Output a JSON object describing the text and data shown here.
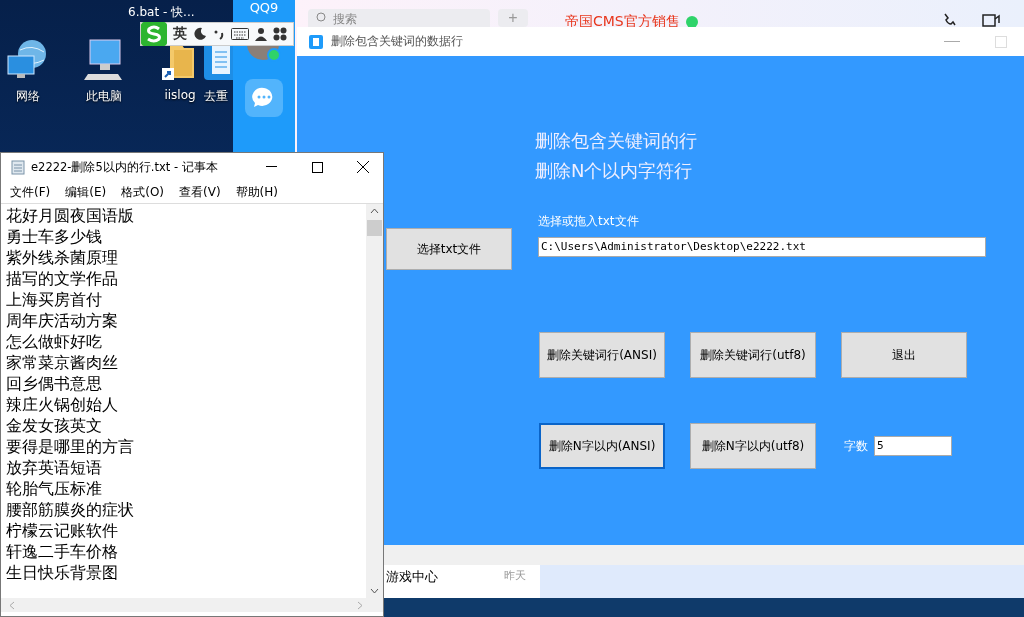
{
  "desktop": {
    "top_label": "6.bat - 快...",
    "icons": [
      {
        "label": "网络",
        "kind": "network"
      },
      {
        "label": "此电脑",
        "kind": "computer"
      },
      {
        "label": "iislog",
        "kind": "folder"
      },
      {
        "label": "去重",
        "kind": "app"
      }
    ]
  },
  "ime_bar": {
    "mode": "英"
  },
  "qq": {
    "logo": "QQ9",
    "search": {
      "placeholder": "搜索"
    },
    "add": "+",
    "chat_title": "帝国CMS官方销售",
    "online": true,
    "list": [
      {
        "name": "游戏中心",
        "time": "昨天"
      }
    ]
  },
  "app_window": {
    "title": "删除包含关键词的数据行",
    "headings": [
      "删除包含关键词的行",
      "删除N个以内字符行"
    ],
    "choose_button": "选择txt文件",
    "file_label": "选择或拖入txt文件",
    "file_path": "C:\\Users\\Administrator\\Desktop\\e2222.txt",
    "buttons": [
      {
        "label": "删除关键词行(ANSI)",
        "focused": false
      },
      {
        "label": "删除关键词行(utf8)",
        "focused": false
      },
      {
        "label": "退出",
        "focused": false
      },
      {
        "label": "删除N字以内(ANSI)",
        "focused": true
      },
      {
        "label": "删除N字以内(utf8)",
        "focused": false
      }
    ],
    "count_label": "字数",
    "count_value": "5"
  },
  "notepad": {
    "title": "e2222-删除5以内的行.txt - 记事本",
    "menu": [
      "文件(F)",
      "编辑(E)",
      "格式(O)",
      "查看(V)",
      "帮助(H)"
    ],
    "lines": [
      "花好月圆夜国语版",
      "勇士车多少钱",
      "紫外线杀菌原理",
      "描写的文学作品",
      "上海买房首付",
      "周年庆活动方案",
      "怎么做虾好吃",
      "家常菜京酱肉丝",
      "回乡偶书意思",
      "辣庄火锅创始人",
      "金发女孩英文",
      "要得是哪里的方言",
      "放弃英语短语",
      "轮胎气压标准",
      "腰部筋膜炎的症状",
      "柠檬云记账软件",
      "轩逸二手车价格",
      "生日快乐背景图"
    ]
  }
}
